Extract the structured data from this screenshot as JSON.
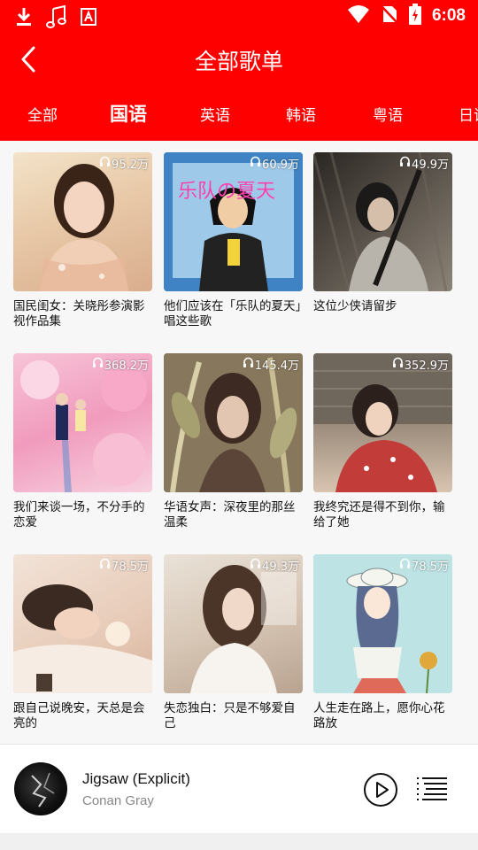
{
  "status_bar": {
    "time": "6:08",
    "icons": [
      "download-icon",
      "music-note-icon",
      "app-badge-icon",
      "wifi-icon",
      "no-sim-icon",
      "battery-charging-icon"
    ]
  },
  "header": {
    "back_icon": "chevron-left-icon",
    "title": "全部歌单"
  },
  "tabs": [
    {
      "label": "全部",
      "active": false
    },
    {
      "label": "国语",
      "active": true
    },
    {
      "label": "英语",
      "active": false
    },
    {
      "label": "韩语",
      "active": false
    },
    {
      "label": "粤语",
      "active": false
    },
    {
      "label": "日语",
      "active": false
    }
  ],
  "playlists": [
    {
      "title": "国民闺女：关晓彤参演影视作品集",
      "plays": "95.2万"
    },
    {
      "title": "他们应该在「乐队的夏天」唱这些歌",
      "plays": "60.9万",
      "cover_text": "乐队の夏天"
    },
    {
      "title": "这位少侠请留步",
      "plays": "49.9万"
    },
    {
      "title": "我们来谈一场，不分手的恋爱",
      "plays": "368.2万"
    },
    {
      "title": "华语女声：深夜里的那丝温柔",
      "plays": "145.4万"
    },
    {
      "title": "我终究还是得不到你，输给了她",
      "plays": "352.9万"
    },
    {
      "title": "跟自己说晚安，天总是会亮的",
      "plays": "78.5万"
    },
    {
      "title": "失恋独白：只是不够爱自己",
      "plays": "49.3万"
    },
    {
      "title": "人生走在路上，愿你心花路放",
      "plays": "78.5万"
    }
  ],
  "player": {
    "song": "Jigsaw (Explicit)",
    "artist": "Conan Gray",
    "play_icon": "play-circle-icon",
    "playlist_icon": "playlist-icon"
  },
  "colors": {
    "primary": "#ff0000",
    "background": "#f7f7f7"
  }
}
